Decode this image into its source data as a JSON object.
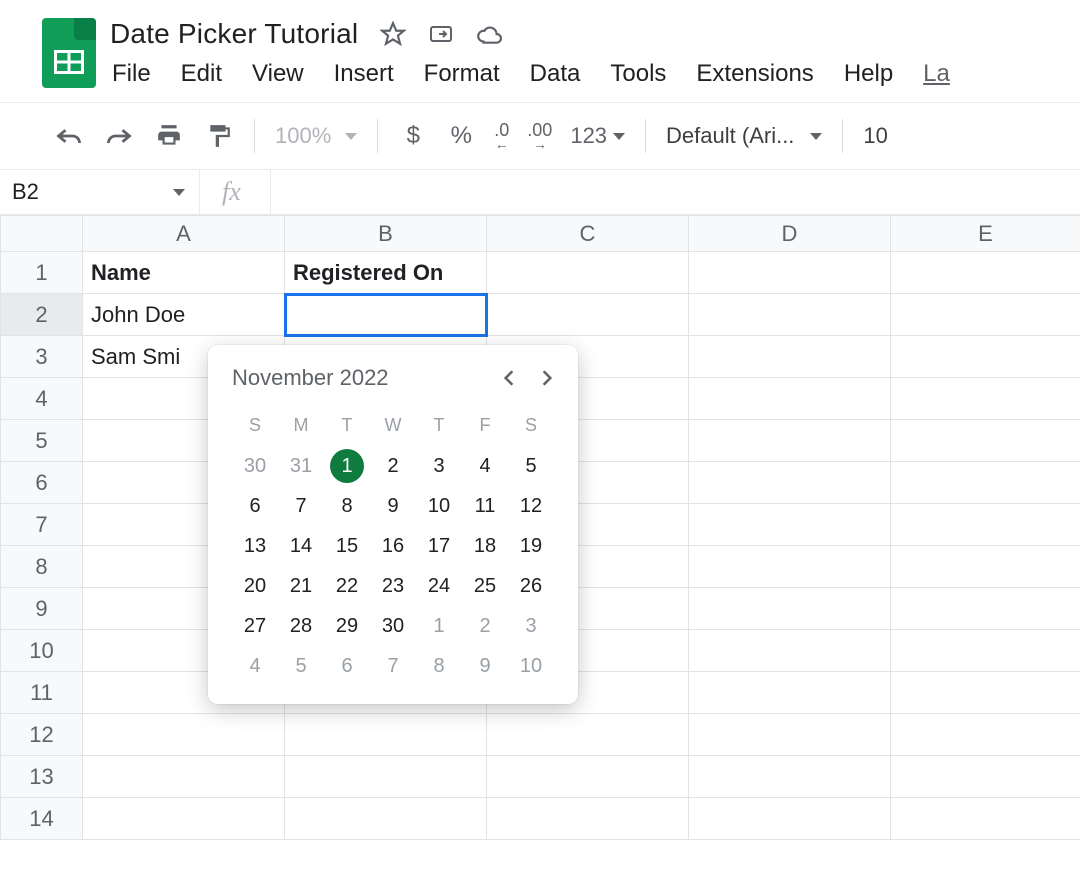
{
  "header": {
    "title": "Date Picker Tutorial",
    "menu": [
      "File",
      "Edit",
      "View",
      "Insert",
      "Format",
      "Data",
      "Tools",
      "Extensions",
      "Help",
      "La"
    ]
  },
  "toolbar": {
    "zoom": "100%",
    "format123": "123",
    "font": "Default (Ari...",
    "font_size": "10"
  },
  "namebox": "B2",
  "columns": [
    "A",
    "B",
    "C",
    "D",
    "E"
  ],
  "rows": [
    "1",
    "2",
    "3",
    "4",
    "5",
    "6",
    "7",
    "8",
    "9",
    "10",
    "11",
    "12",
    "13",
    "14"
  ],
  "cells": {
    "A1": "Name",
    "B1": "Registered On",
    "A2": "John Doe",
    "A3": "Sam Smi"
  },
  "selected_cell": "B2",
  "datepicker": {
    "month_label": "November 2022",
    "dow": [
      "S",
      "M",
      "T",
      "W",
      "T",
      "F",
      "S"
    ],
    "weeks": [
      [
        {
          "d": "30",
          "out": true
        },
        {
          "d": "31",
          "out": true
        },
        {
          "d": "1",
          "today": true
        },
        {
          "d": "2"
        },
        {
          "d": "3"
        },
        {
          "d": "4"
        },
        {
          "d": "5"
        }
      ],
      [
        {
          "d": "6"
        },
        {
          "d": "7"
        },
        {
          "d": "8"
        },
        {
          "d": "9"
        },
        {
          "d": "10"
        },
        {
          "d": "11"
        },
        {
          "d": "12"
        }
      ],
      [
        {
          "d": "13"
        },
        {
          "d": "14"
        },
        {
          "d": "15"
        },
        {
          "d": "16"
        },
        {
          "d": "17"
        },
        {
          "d": "18"
        },
        {
          "d": "19"
        }
      ],
      [
        {
          "d": "20"
        },
        {
          "d": "21"
        },
        {
          "d": "22"
        },
        {
          "d": "23"
        },
        {
          "d": "24"
        },
        {
          "d": "25"
        },
        {
          "d": "26"
        }
      ],
      [
        {
          "d": "27"
        },
        {
          "d": "28"
        },
        {
          "d": "29"
        },
        {
          "d": "30"
        },
        {
          "d": "1",
          "out": true
        },
        {
          "d": "2",
          "out": true
        },
        {
          "d": "3",
          "out": true
        }
      ],
      [
        {
          "d": "4",
          "out": true
        },
        {
          "d": "5",
          "out": true
        },
        {
          "d": "6",
          "out": true
        },
        {
          "d": "7",
          "out": true
        },
        {
          "d": "8",
          "out": true
        },
        {
          "d": "9",
          "out": true
        },
        {
          "d": "10",
          "out": true
        }
      ]
    ]
  }
}
